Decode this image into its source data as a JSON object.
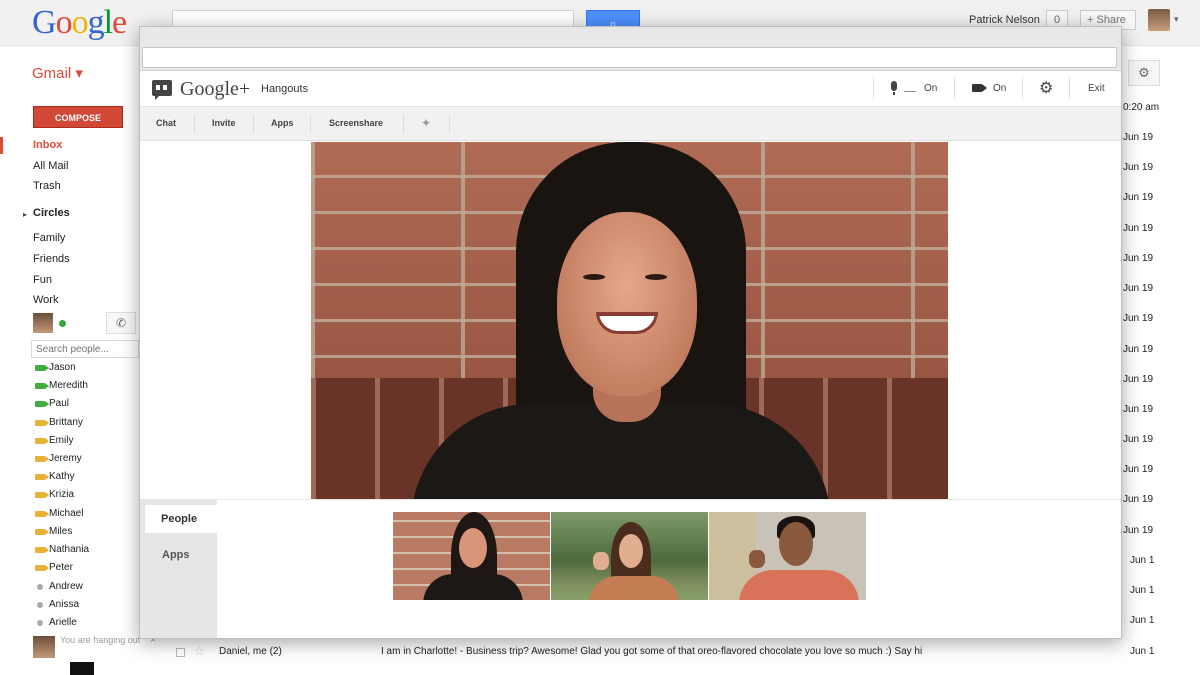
{
  "gmail": {
    "logo": "Google",
    "search_button_icon": "search-icon",
    "user_name": "Patrick Nelson",
    "notification_count": "0",
    "share_label": "+ Share",
    "gmail_label": "Gmail ▾",
    "compose_label": "COMPOSE",
    "nav": {
      "inbox": "Inbox",
      "all_mail": "All Mail",
      "trash": "Trash",
      "circles": "Circles",
      "family": "Family",
      "friends": "Friends",
      "fun": "Fun",
      "work": "Work"
    },
    "search_people_placeholder": "Search people...",
    "contacts": [
      {
        "name": "Jason",
        "status": "video-green"
      },
      {
        "name": "Meredith",
        "status": "video-green"
      },
      {
        "name": "Paul",
        "status": "video-green"
      },
      {
        "name": "Brittany",
        "status": "video-yellow"
      },
      {
        "name": "Emily",
        "status": "video-yellow"
      },
      {
        "name": "Jeremy",
        "status": "video-yellow"
      },
      {
        "name": "Kathy",
        "status": "video-yellow"
      },
      {
        "name": "Krizia",
        "status": "video-yellow"
      },
      {
        "name": "Michael",
        "status": "video-yellow"
      },
      {
        "name": "Miles",
        "status": "video-yellow"
      },
      {
        "name": "Nathania",
        "status": "video-yellow"
      },
      {
        "name": "Peter",
        "status": "video-yellow"
      },
      {
        "name": "Andrew",
        "status": "offline"
      },
      {
        "name": "Anissa",
        "status": "offline"
      },
      {
        "name": "Arielle",
        "status": "offline"
      }
    ],
    "chat_bar_text": "You are hanging out",
    "chat_bar_close": "×",
    "email_times": [
      "0:20 am",
      "Jun 19",
      "Jun 19",
      "Jun 19",
      "Jun 19",
      "Jun 19",
      "Jun 19",
      "Jun 19",
      "Jun 19",
      "Jun 19",
      "Jun 19",
      "Jun 19",
      "Jun 19",
      "Jun 19",
      "Jun 19",
      "Jun 1",
      "Jun 1",
      "Jun 1"
    ],
    "bottom_email": {
      "sender": "Daniel, me (2)",
      "subject": "I am in Charlotte! - Business trip? Awesome! Glad you got some of that oreo-flavored chocolate you love so much :) Say hi",
      "date": "Jun 1"
    }
  },
  "hangout": {
    "brand": "Google+",
    "product": "Hangouts",
    "mic_state": "On",
    "camera_state": "On",
    "exit_label": "Exit",
    "tabs": [
      "Chat",
      "Invite",
      "Apps",
      "Screenshare"
    ],
    "side_tabs": {
      "people": "People",
      "apps": "Apps"
    },
    "participants": [
      "participant-1",
      "participant-2",
      "participant-3"
    ],
    "colors": {
      "accent": "#dd4b39",
      "compose": "#d14836",
      "search": "#4d90fe"
    }
  }
}
